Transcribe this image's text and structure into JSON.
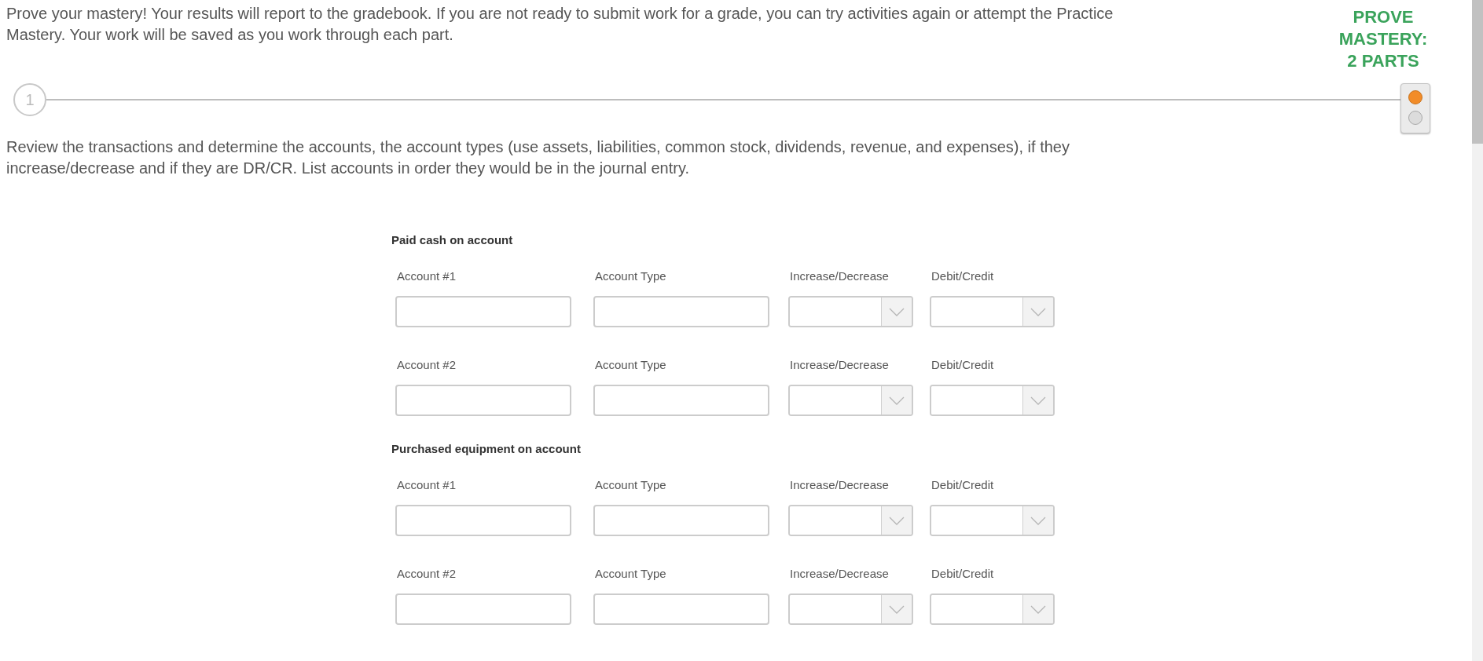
{
  "intro": "Prove your mastery! Your results will report to the gradebook. If you are not ready to submit work for a grade, you can try activities again or attempt the Practice Mastery. Your work will be saved as you work through each part.",
  "badge": {
    "lines": [
      "PROVE",
      "MASTERY:",
      "2 PARTS"
    ]
  },
  "steps": [
    {
      "number": "1",
      "selected": false
    }
  ],
  "parts": [
    {
      "selected": true
    },
    {
      "selected": false
    }
  ],
  "instructions": "Review the transactions and determine the accounts, the account types (use assets, liabilities, common stock, dividends, revenue, and expenses), if they increase/decrease and if they are DR/CR. List accounts in order they would be in the journal entry.",
  "transactions": [
    {
      "title": "Paid cash on account",
      "entries": [
        {
          "fields": [
            {
              "label": "Account #1",
              "kind": "text"
            },
            {
              "label": "Account Type",
              "kind": "text"
            },
            {
              "label": "Increase/Decrease",
              "kind": "select"
            },
            {
              "label": "Debit/Credit",
              "kind": "select"
            }
          ]
        },
        {
          "fields": [
            {
              "label": "Account #2",
              "kind": "text"
            },
            {
              "label": "Account Type",
              "kind": "text"
            },
            {
              "label": "Increase/Decrease",
              "kind": "select"
            },
            {
              "label": "Debit/Credit",
              "kind": "select"
            }
          ]
        }
      ]
    },
    {
      "title": "Purchased equipment on account",
      "entries": [
        {
          "fields": [
            {
              "label": "Account #1",
              "kind": "text"
            },
            {
              "label": "Account Type",
              "kind": "text"
            },
            {
              "label": "Increase/Decrease",
              "kind": "select"
            },
            {
              "label": "Debit/Credit",
              "kind": "select"
            }
          ]
        },
        {
          "fields": [
            {
              "label": "Account #2",
              "kind": "text"
            },
            {
              "label": "Account Type",
              "kind": "text"
            },
            {
              "label": "Increase/Decrease",
              "kind": "select"
            },
            {
              "label": "Debit/Credit",
              "kind": "select"
            }
          ]
        }
      ]
    }
  ]
}
